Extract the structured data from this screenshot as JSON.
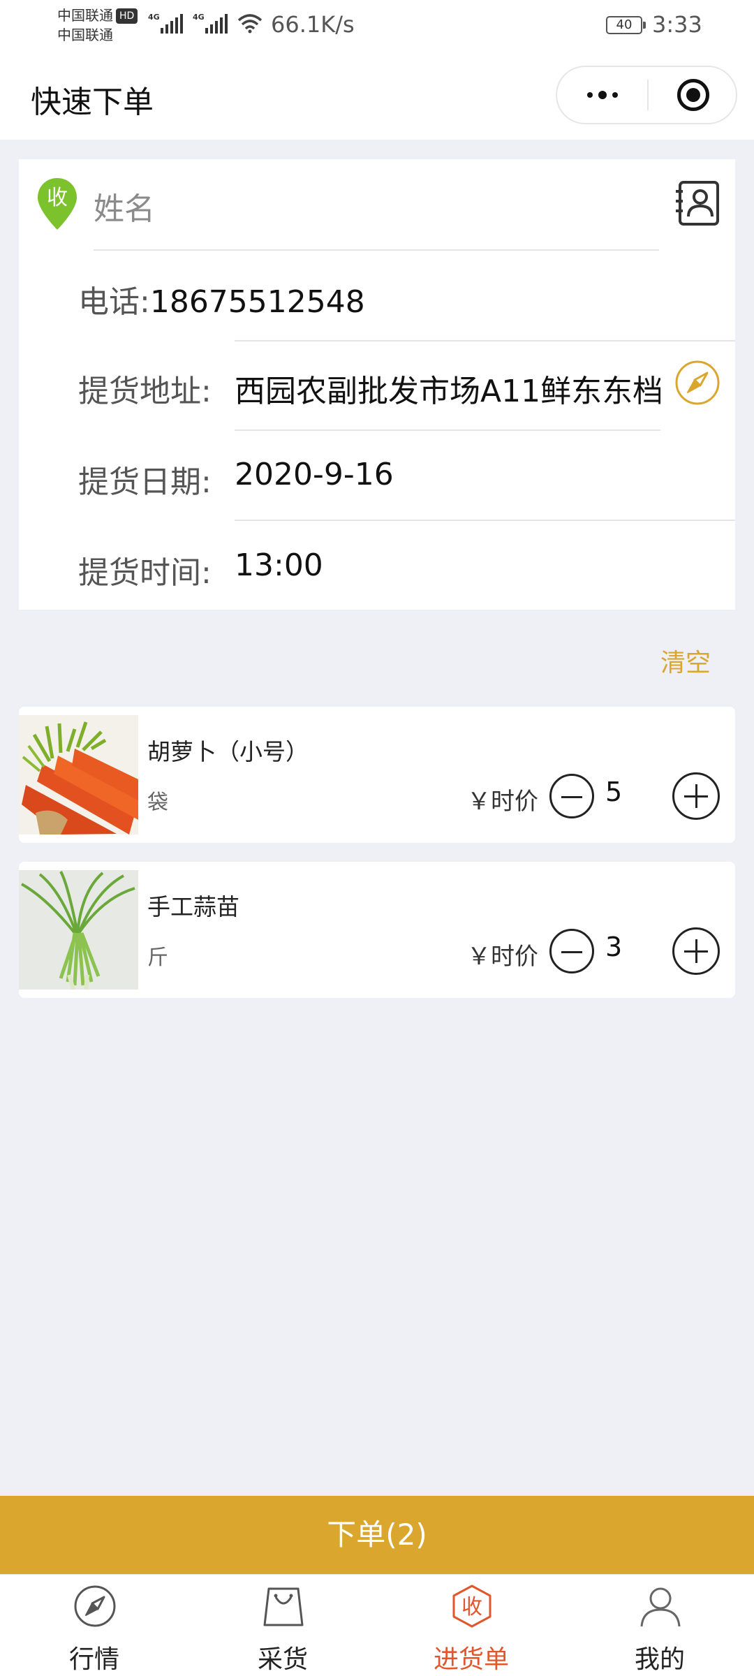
{
  "status_bar": {
    "carrier1": "中国联通",
    "hd": "HD",
    "carrier2": "中国联通",
    "net_type": "4G",
    "net_speed": "66.1K/s",
    "battery": "40",
    "time": "3:33"
  },
  "nav": {
    "title": "快速下单"
  },
  "receiver": {
    "badge": "收",
    "name_placeholder": "姓名",
    "phone_label": "电话:",
    "phone_value": "18675512548",
    "address_label": "提货地址:",
    "address_value": "西园农副批发市场A11鲜东东档",
    "date_label": "提货日期:",
    "date_value": "2020-9-16",
    "time_label": "提货时间:",
    "time_value": "13:00"
  },
  "clear_label": "清空",
  "products": [
    {
      "name": "胡萝卜（小号）",
      "unit": "袋",
      "price": "￥时价",
      "qty": "5"
    },
    {
      "name": "手工蒜苗",
      "unit": "斤",
      "price": "￥时价",
      "qty": "3"
    }
  ],
  "submit_label": "下单(2)",
  "tabs": [
    {
      "label": "行情",
      "icon": "compass-icon"
    },
    {
      "label": "采货",
      "icon": "shopping-bag-icon"
    },
    {
      "label": "进货单",
      "icon": "receive-badge-icon"
    },
    {
      "label": "我的",
      "icon": "user-icon"
    }
  ],
  "colors": {
    "accent": "#daa62e",
    "active_tab": "#e0572c",
    "pin_green": "#7bc22c",
    "background": "#efeff6"
  }
}
